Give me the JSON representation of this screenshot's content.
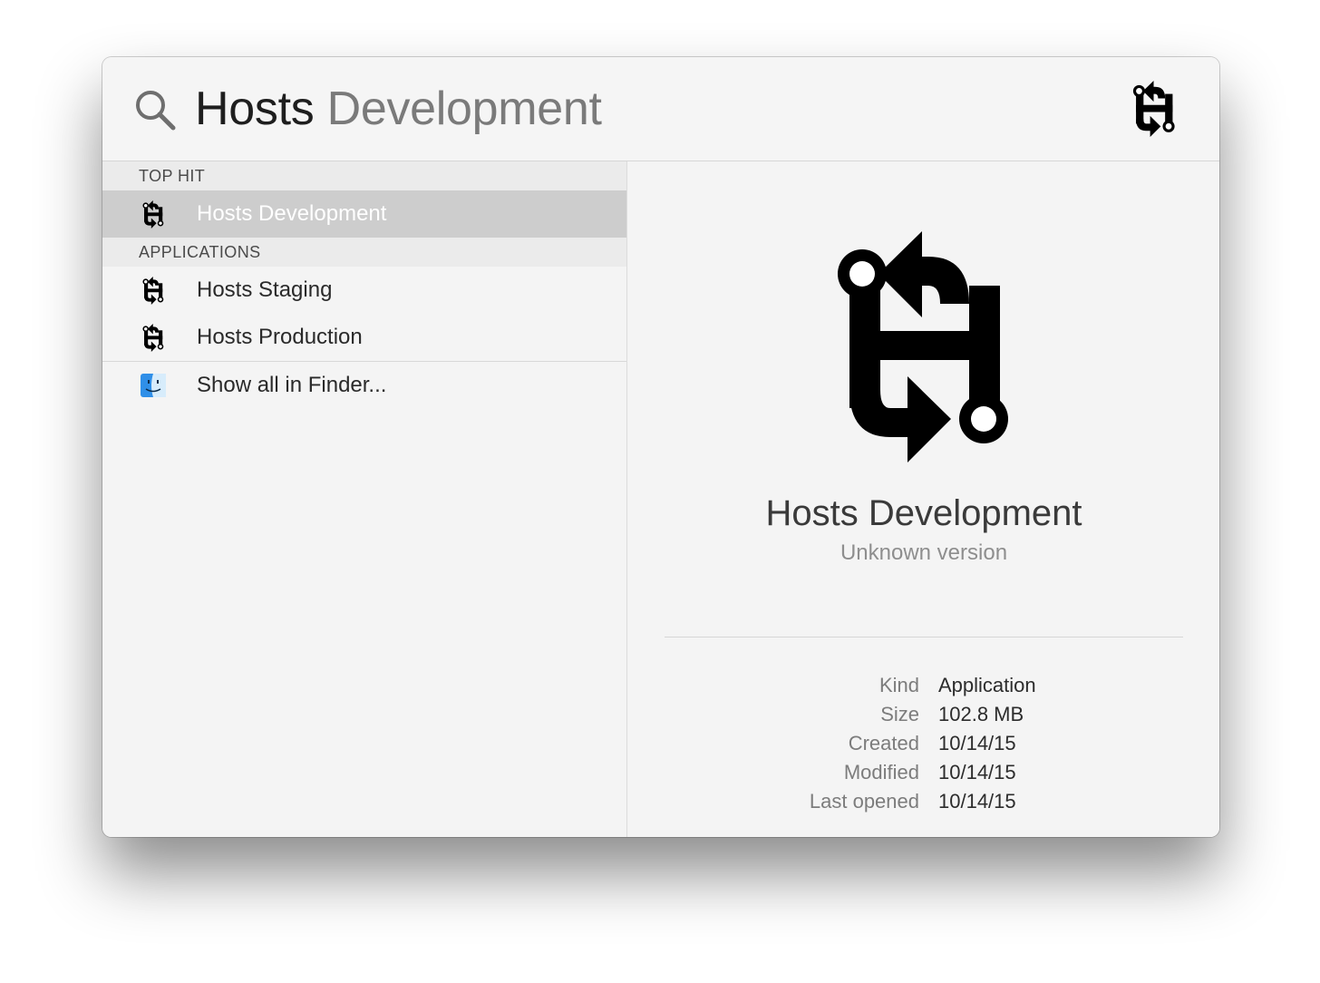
{
  "search": {
    "typed": "Hosts",
    "completion": " Development",
    "header_icon": "hosts-app-icon"
  },
  "results": {
    "sections": [
      {
        "header": "TOP HIT",
        "items": [
          {
            "label": "Hosts Development",
            "icon": "hosts-app-icon",
            "selected": true
          }
        ]
      },
      {
        "header": "APPLICATIONS",
        "items": [
          {
            "label": "Hosts Staging",
            "icon": "hosts-app-icon",
            "selected": false
          },
          {
            "label": "Hosts Production",
            "icon": "hosts-app-icon",
            "selected": false
          }
        ]
      }
    ],
    "show_all": {
      "label": "Show all in Finder...",
      "icon": "finder-icon"
    }
  },
  "preview": {
    "icon": "hosts-app-icon",
    "title": "Hosts Development",
    "version": "Unknown version",
    "metadata": [
      {
        "key": "Kind",
        "value": "Application"
      },
      {
        "key": "Size",
        "value": "102.8 MB"
      },
      {
        "key": "Created",
        "value": "10/14/15"
      },
      {
        "key": "Modified",
        "value": "10/14/15"
      },
      {
        "key": "Last opened",
        "value": "10/14/15"
      }
    ]
  },
  "colors": {
    "selection": "#cdcdcd",
    "window_bg": "#f4f4f4",
    "section_header_bg": "#ebebeb"
  }
}
